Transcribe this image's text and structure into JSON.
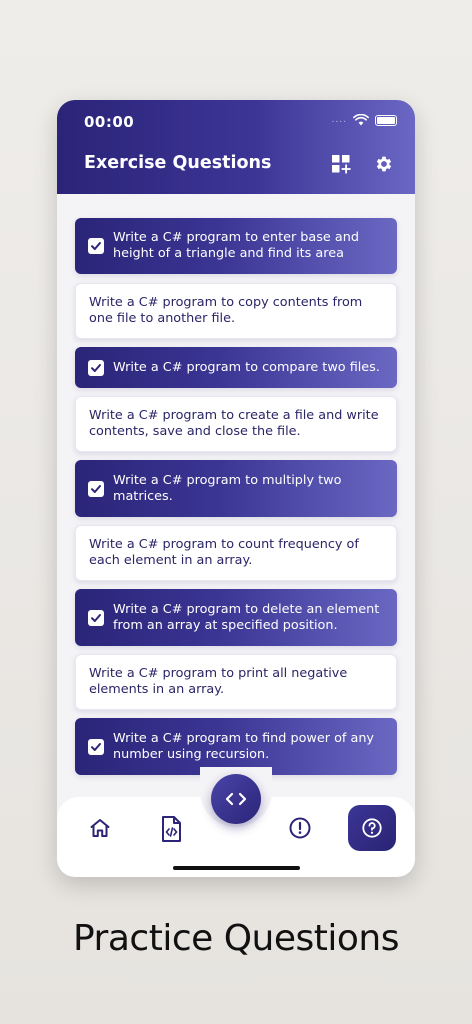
{
  "status_bar": {
    "time": "00:00",
    "signal_dots": "...."
  },
  "app_bar": {
    "title": "Exercise Questions",
    "icons": [
      "grid-add-icon",
      "gear-icon"
    ]
  },
  "questions": [
    {
      "text": "Write a C# program to enter base and height of a triangle and find its area",
      "checked": true
    },
    {
      "text": "Write a C# program to copy contents from one file to another file.",
      "checked": false
    },
    {
      "text": "Write a C# program to compare two files.",
      "checked": true
    },
    {
      "text": "Write a C# program to create a file and write contents, save and close the file.",
      "checked": false
    },
    {
      "text": "Write a C# program to multiply two matrices.",
      "checked": true
    },
    {
      "text": "Write a C# program to count frequency of each element in an array.",
      "checked": false
    },
    {
      "text": "Write a C# program to delete an element from an array at specified position.",
      "checked": true
    },
    {
      "text": "Write a C# program to print all negative elements in an array.",
      "checked": false
    },
    {
      "text": "Write a C# program to find power of any number using recursion.",
      "checked": true
    }
  ],
  "bottom_nav": {
    "items": [
      "home-icon",
      "code-file-icon",
      "code-icon",
      "alert-circle-icon",
      "help-circle-icon"
    ],
    "active": "help-circle-icon"
  },
  "caption": "Practice Questions",
  "colors": {
    "primary_dark": "#2b2478",
    "primary_light": "#6b67c4",
    "text_dark": "#2a2567"
  }
}
